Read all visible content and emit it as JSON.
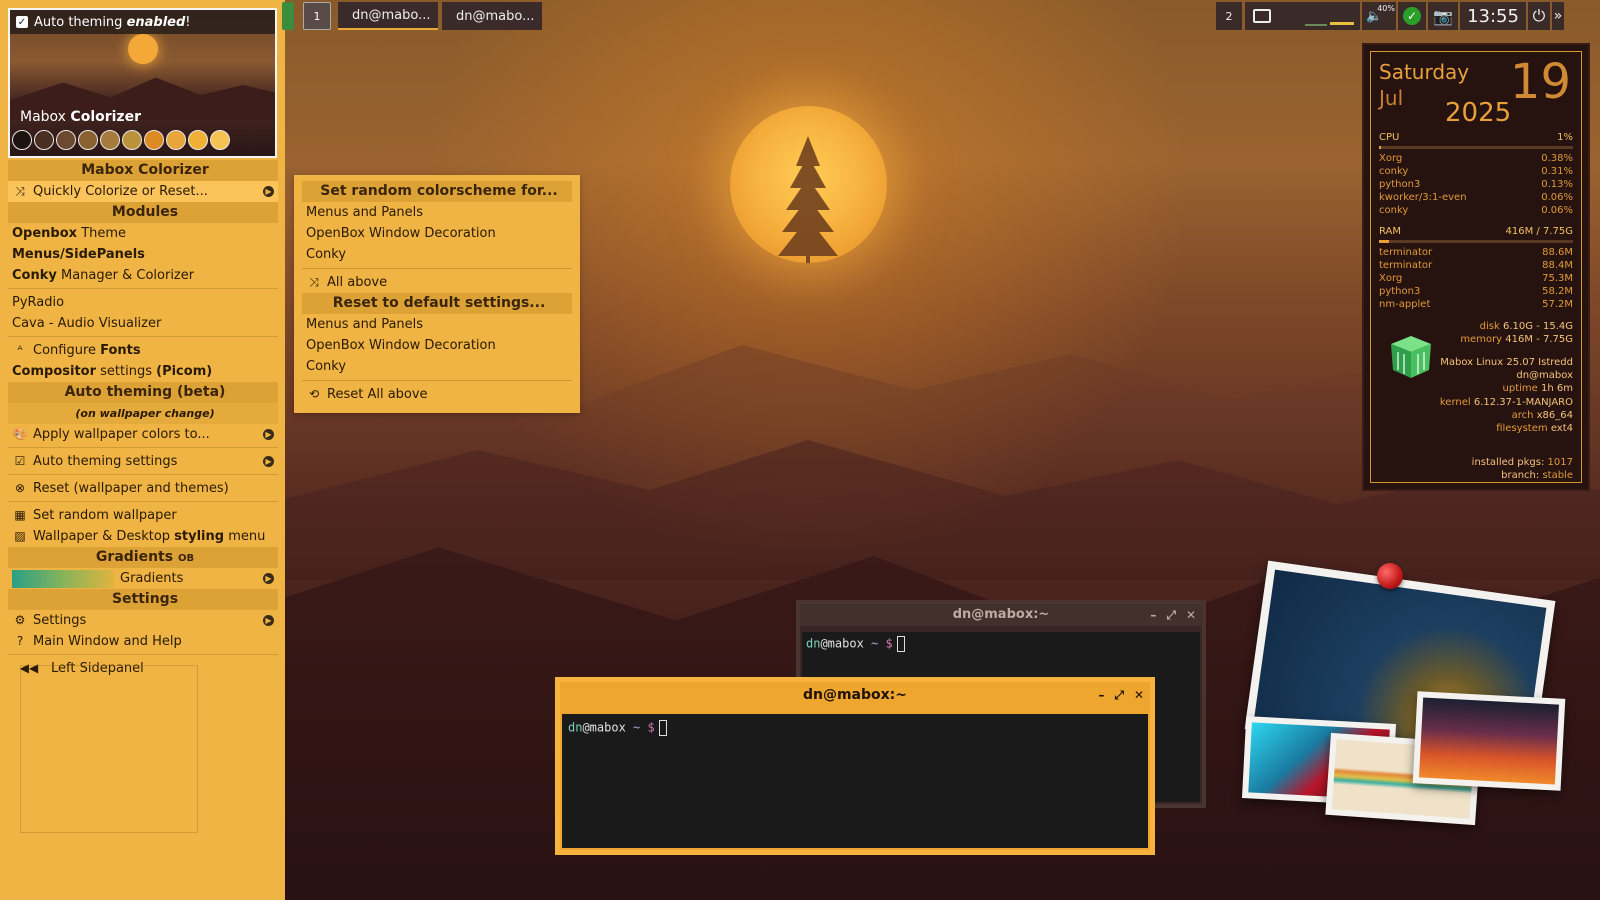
{
  "colors": {
    "panel": "#efb443",
    "panel_header": "#d08c28",
    "conky_accent": "#e8a13a",
    "terminal_bg": "#1a1a1a"
  },
  "preview": {
    "auto_theming": "Auto theming ",
    "auto_theming_em": "enabled",
    "auto_theming_bang": "!",
    "title_prefix": "Mabox ",
    "title_bold": "Colorizer",
    "swatches": [
      "#1d1410",
      "#4a2e22",
      "#6c4a30",
      "#8a6232",
      "#a57a3a",
      "#b9923a",
      "#dd8a24",
      "#e7a53a",
      "#f0b036",
      "#f6c252"
    ]
  },
  "sidepanel": {
    "header_colorizer": "Mabox Colorizer",
    "quick_colorize": "Quickly Colorize or Reset...",
    "header_modules": "Modules",
    "openbox_b": "Openbox",
    "openbox_rest": " Theme",
    "menus_sidepanels": "Menus/SidePanels",
    "conky_b": "Conky",
    "conky_rest": " Manager & Colorizer",
    "pyradio": "PyRadio",
    "cava": "Cava - Audio Visualizer",
    "configure": "Configure ",
    "fonts": "Fonts",
    "compositor_b": "Compositor",
    "compositor_rest": " settings ",
    "picom": "(Picom)",
    "header_auto": "Auto theming (beta)",
    "on_wallpaper": "(on wallpaper change)",
    "apply_colors": "Apply wallpaper colors to...",
    "auto_settings": "Auto theming settings",
    "reset_wall": "Reset (wallpaper and themes)",
    "random_wall": "Set random wallpaper",
    "wall_desktop": "Wallpaper & Desktop ",
    "styling": "styling",
    "menu_word": " menu",
    "header_gradients": "Gradients",
    "ob": "OB",
    "gradients": "Gradients",
    "header_settings": "Settings",
    "settings": "Settings",
    "main_window": "Main Window and Help",
    "left_sidepanel": "Left Sidepanel"
  },
  "taskbar": {
    "workspace": "1",
    "task1": "dn@mabo...",
    "task2": "dn@mabo..."
  },
  "tray": {
    "count": "2",
    "volume": "40%",
    "clock": "13:55"
  },
  "popup": {
    "header_random": "Set random colorscheme for...",
    "menus_panels": "Menus and Panels",
    "openbox_deco": "OpenBox Window Decoration",
    "conky": "Conky",
    "all_above": "All above",
    "header_reset": "Reset to default settings...",
    "menus_panels2": "Menus and Panels",
    "openbox_deco2": "OpenBox Window Decoration",
    "conky2": "Conky",
    "reset_all": "Reset All above"
  },
  "conky": {
    "day": "Saturday",
    "month": "Jul",
    "year": "2025",
    "date": "19",
    "cpu_label": "CPU",
    "cpu_value": "1%",
    "cpu_fraction": 0.01,
    "cpu_procs": [
      {
        "name": "Xorg",
        "value": "0.38%"
      },
      {
        "name": "conky",
        "value": "0.31%"
      },
      {
        "name": "python3",
        "value": "0.13%"
      },
      {
        "name": "kworker/3:1-even",
        "value": "0.06%"
      },
      {
        "name": "conky",
        "value": "0.06%"
      }
    ],
    "ram_label": "RAM",
    "ram_value": "416M / 7.75G",
    "ram_fraction": 0.054,
    "ram_procs": [
      {
        "name": "terminator",
        "value": "88.6M"
      },
      {
        "name": "terminator",
        "value": "88.4M"
      },
      {
        "name": "Xorg",
        "value": "75.3M"
      },
      {
        "name": "python3",
        "value": "58.2M"
      },
      {
        "name": "nm-applet",
        "value": "57.2M"
      }
    ],
    "disk_label": "disk",
    "disk_value": "6.10G - 15.4G",
    "memory_label": "memory",
    "memory_value": "416M - 7.75G",
    "distro": "Mabox Linux 25.07 Istredd",
    "user": "dn@mabox",
    "uptime_label": "uptime",
    "uptime_value": "1h 6m",
    "kernel_label": "kernel",
    "kernel_value": "6.12.37-1-MANJARO",
    "arch_label": "arch",
    "arch_value": "x86_64",
    "fs_label": "filesystem",
    "fs_value": "ext4",
    "pkgs_label": "installed pkgs:",
    "pkgs_value": "1017",
    "branch_label": "branch:",
    "branch_value": "stable"
  },
  "terminal_back": {
    "title": "dn@mabox:~",
    "user": "dn",
    "at": "@mabox",
    "dir": "~",
    "sign": "$"
  },
  "terminal_front": {
    "title": "dn@mabox:~",
    "user": "dn",
    "at": "@mabox",
    "dir": "~",
    "sign": "$"
  }
}
